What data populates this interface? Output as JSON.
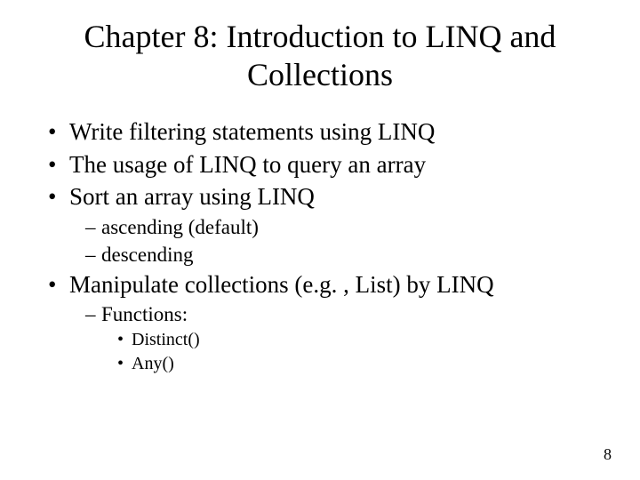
{
  "title": "Chapter 8: Introduction to LINQ and Collections",
  "bullets": {
    "b0": "Write filtering statements using LINQ",
    "b1": "The usage of LINQ to query an array",
    "b2": "Sort an array using LINQ",
    "b2_sub0": "ascending (default)",
    "b2_sub1": "descending",
    "b3": "Manipulate collections (e.g. , List) by LINQ",
    "b3_sub0": "Functions:",
    "b3_sub0_sub0": "Distinct()",
    "b3_sub0_sub1": "Any()"
  },
  "page_number": "8"
}
